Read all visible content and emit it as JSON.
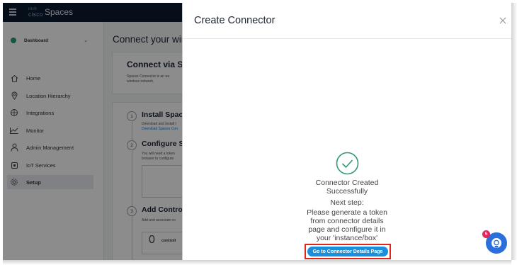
{
  "app": {
    "title": "Spaces",
    "logo_text": "cisco",
    "sidebar": {
      "dashboard_label": "Dashboard",
      "items": [
        {
          "label": "Home",
          "icon": "home-icon"
        },
        {
          "label": "Location Hierarchy",
          "icon": "location-pin-icon"
        },
        {
          "label": "Integrations",
          "icon": "integrations-icon"
        },
        {
          "label": "Monitor",
          "icon": "monitor-icon"
        },
        {
          "label": "Admin Management",
          "icon": "user-icon"
        },
        {
          "label": "IoT Services",
          "icon": "iot-icon"
        },
        {
          "label": "Setup",
          "icon": "gear-icon",
          "active": true
        }
      ]
    },
    "main": {
      "title": "Connect your wir",
      "card_title": "Connect via Sp",
      "card_text_1": "Spaces Connector is an ea",
      "card_text_2": "wireless network.",
      "steps": [
        {
          "num": "1",
          "title": "Install Spac",
          "text": "Download and install t",
          "link": "Download Spaces Con"
        },
        {
          "num": "2",
          "title": "Configure S",
          "text_1": "You will need a token",
          "text_2": "browser to configure"
        },
        {
          "num": "3",
          "title": "Add Contro",
          "text": "Add and associate co",
          "count": "0",
          "count_label": "controll"
        }
      ]
    }
  },
  "drawer": {
    "title": "Create Connector",
    "message_1": "Connector Created",
    "message_2": "Successfully",
    "next_label": "Next step:",
    "instruction_lines": [
      "Please generate a token",
      "from connector details",
      "page and configure it in",
      "your 'instance/box'"
    ],
    "cta_label": "Go to Connector Details Page"
  },
  "widget": {
    "badge_count": "5",
    "icon": "assistant-icon"
  },
  "colors": {
    "accent": "#1a8fdc",
    "success": "#2e9a6d",
    "highlight": "#e0261b",
    "topbar": "#0b1a31"
  }
}
